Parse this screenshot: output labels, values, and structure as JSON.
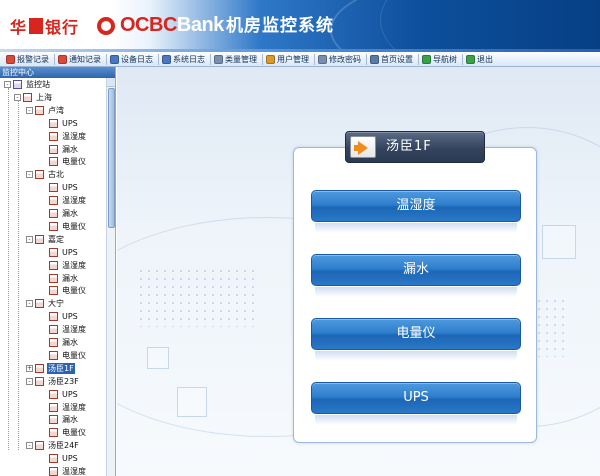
{
  "header": {
    "brand_cn_left": "华",
    "brand_cn_right": "银行",
    "brand_en_ocbc": "OCBC",
    "brand_en_bank": "Bank",
    "system_title": "机房监控系统"
  },
  "toolbar": {
    "items": [
      {
        "label": "报警记录",
        "icon": "alarm-icon",
        "color": "#d94a3a"
      },
      {
        "label": "通知记录",
        "icon": "notice-icon",
        "color": "#d94a3a"
      },
      {
        "label": "设备日志",
        "icon": "device-log-icon",
        "color": "#4a78c2"
      },
      {
        "label": "系统日志",
        "icon": "system-log-icon",
        "color": "#4a78c2"
      },
      {
        "label": "类量管理",
        "icon": "variable-icon",
        "color": "#7a8fb0"
      },
      {
        "label": "用户管理",
        "icon": "user-icon",
        "color": "#d99a2a"
      },
      {
        "label": "修改密码",
        "icon": "password-icon",
        "color": "#7a8fb0"
      },
      {
        "label": "首页设置",
        "icon": "home-settings-icon",
        "color": "#5a7aa8"
      },
      {
        "label": "导航树",
        "icon": "nav-tree-icon",
        "color": "#3aa04a"
      },
      {
        "label": "退出",
        "icon": "exit-icon",
        "color": "#3aa04a"
      }
    ]
  },
  "sidebar": {
    "title": "监控中心",
    "tree": [
      {
        "label": "监控站",
        "level": 0,
        "toggle": "-",
        "root": true
      },
      {
        "label": "上海",
        "level": 1,
        "toggle": "-"
      },
      {
        "label": "卢湾",
        "level": 2,
        "toggle": "-"
      },
      {
        "label": "UPS",
        "level": 3
      },
      {
        "label": "温湿度",
        "level": 3
      },
      {
        "label": "漏水",
        "level": 3
      },
      {
        "label": "电量仪",
        "level": 3
      },
      {
        "label": "古北",
        "level": 2,
        "toggle": "-"
      },
      {
        "label": "UPS",
        "level": 3
      },
      {
        "label": "温湿度",
        "level": 3
      },
      {
        "label": "漏水",
        "level": 3
      },
      {
        "label": "电量仪",
        "level": 3
      },
      {
        "label": "嘉定",
        "level": 2,
        "toggle": "-"
      },
      {
        "label": "UPS",
        "level": 3
      },
      {
        "label": "温湿度",
        "level": 3
      },
      {
        "label": "漏水",
        "level": 3
      },
      {
        "label": "电量仪",
        "level": 3
      },
      {
        "label": "大宁",
        "level": 2,
        "toggle": "-"
      },
      {
        "label": "UPS",
        "level": 3
      },
      {
        "label": "温湿度",
        "level": 3
      },
      {
        "label": "漏水",
        "level": 3
      },
      {
        "label": "电量仪",
        "level": 3
      },
      {
        "label": "汤臣1F",
        "level": 2,
        "toggle": "+",
        "selected": true
      },
      {
        "label": "汤臣23F",
        "level": 2,
        "toggle": "-"
      },
      {
        "label": "UPS",
        "level": 3
      },
      {
        "label": "温湿度",
        "level": 3
      },
      {
        "label": "漏水",
        "level": 3
      },
      {
        "label": "电量仪",
        "level": 3
      },
      {
        "label": "汤臣24F",
        "level": 2,
        "toggle": "-"
      },
      {
        "label": "UPS",
        "level": 3
      },
      {
        "label": "温湿度",
        "level": 3
      }
    ]
  },
  "main": {
    "panel_title": "汤臣1F",
    "buttons": [
      {
        "label": "温湿度",
        "name": "temp-humidity-button"
      },
      {
        "label": "漏水",
        "name": "water-leak-button"
      },
      {
        "label": "电量仪",
        "name": "power-meter-button"
      },
      {
        "label": "UPS",
        "name": "ups-button"
      }
    ]
  },
  "colors": {
    "brand_red": "#d7261e",
    "header_blue": "#0d4f9c",
    "button_blue": "#2f7fcd",
    "selection": "#2d62b0"
  }
}
